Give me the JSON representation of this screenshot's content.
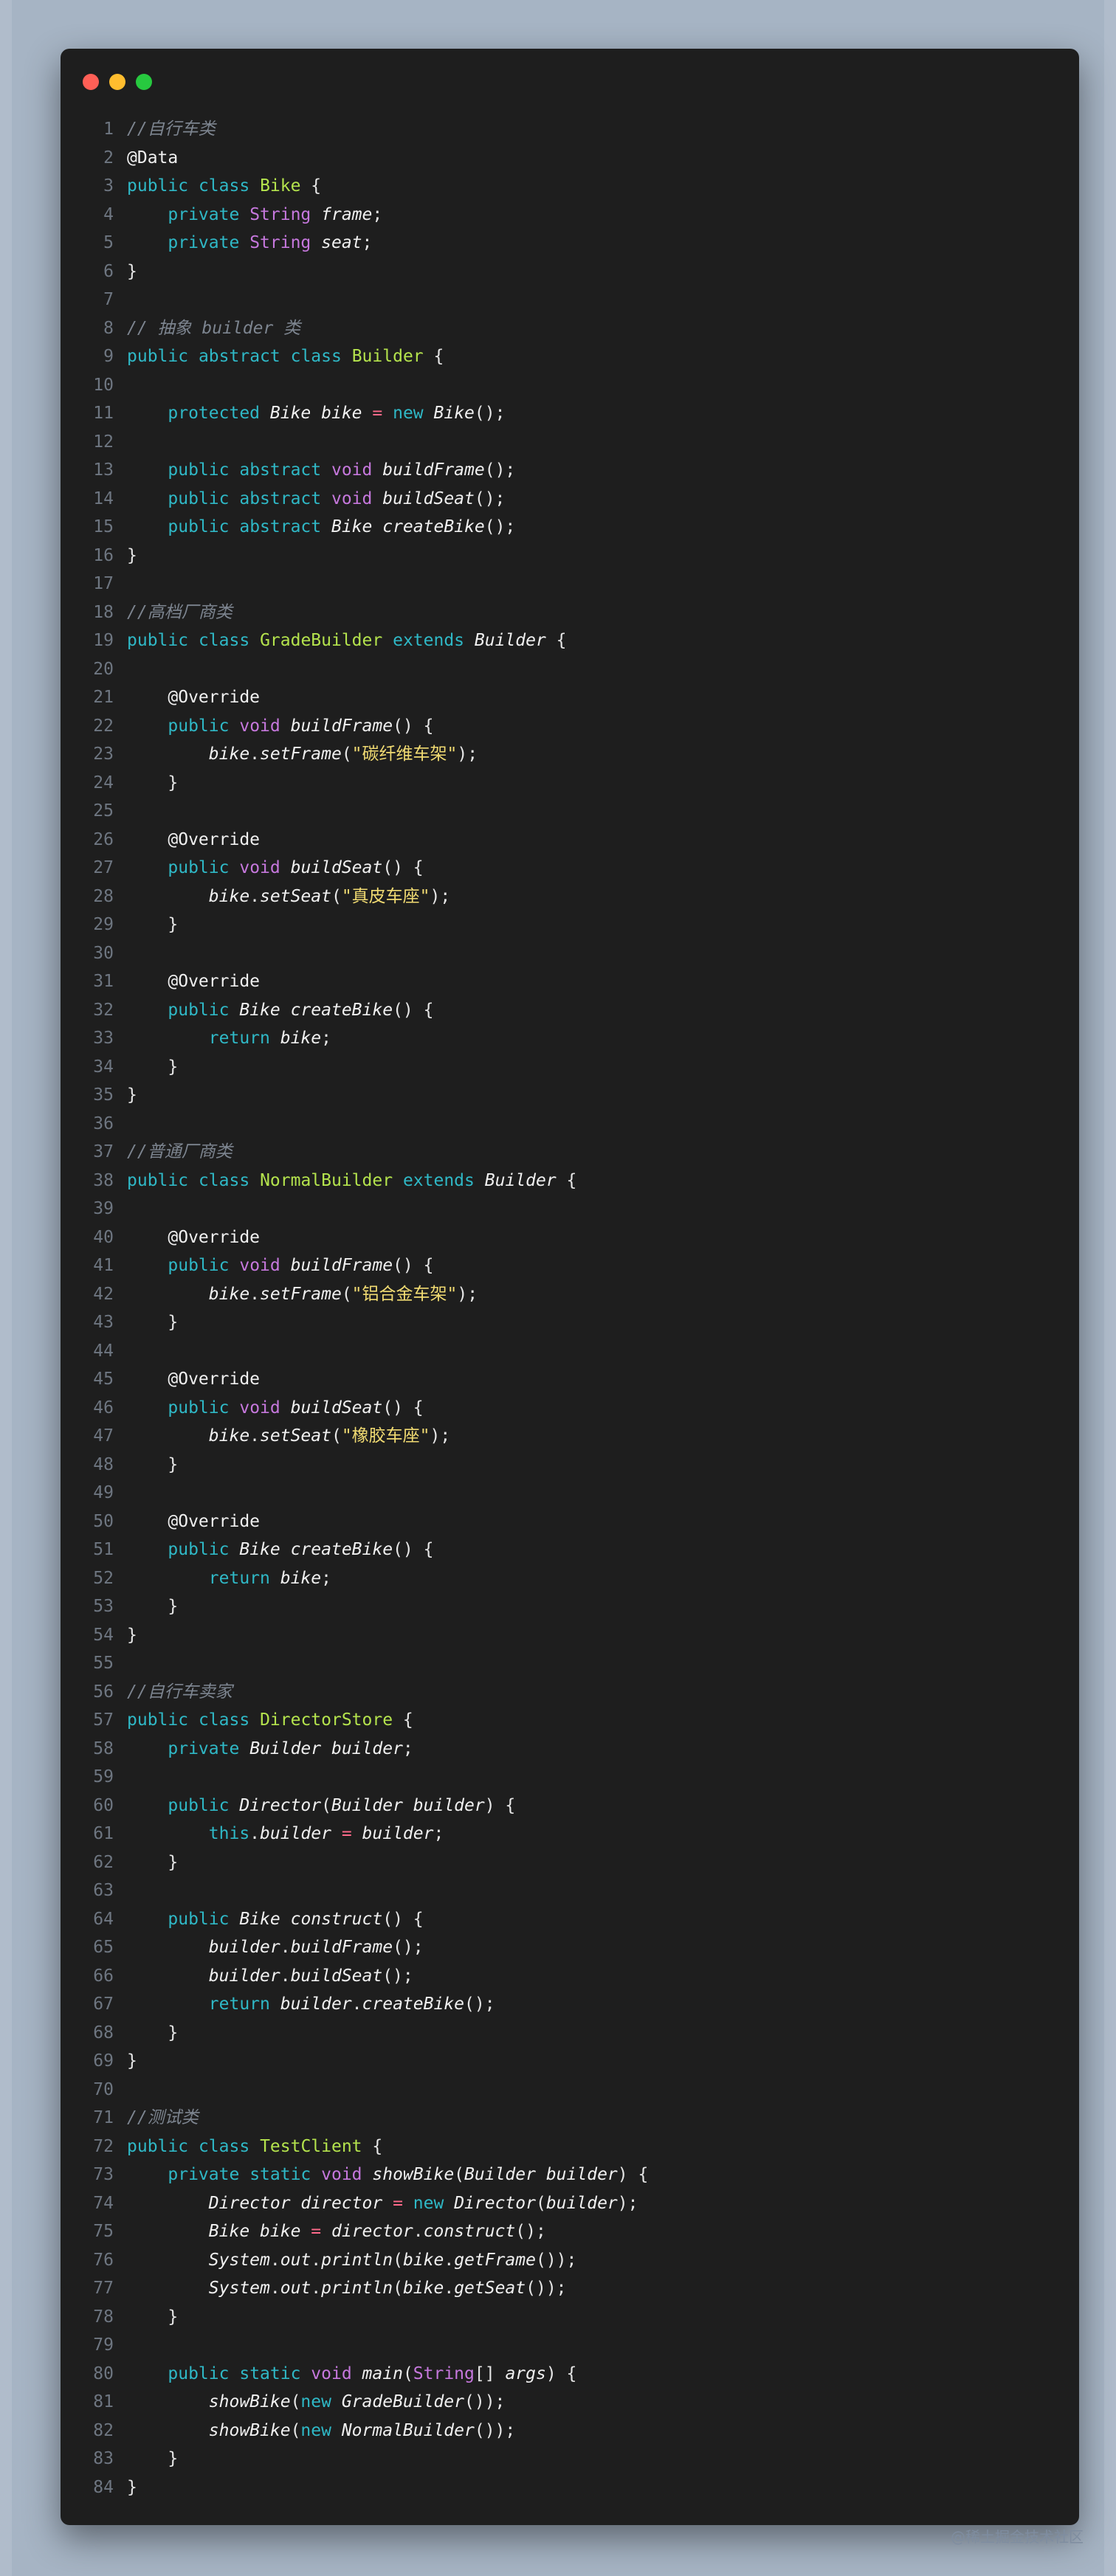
{
  "window_controls": {
    "close_color": "#ff5f56",
    "minimize_color": "#ffbd2e",
    "maximize_color": "#27c93f"
  },
  "code_lines": [
    [
      [
        "cm",
        "//自行车类"
      ]
    ],
    [
      [
        "an",
        "@Data"
      ]
    ],
    [
      [
        "kw",
        "public"
      ],
      [
        "pl",
        " "
      ],
      [
        "kw",
        "class"
      ],
      [
        "pl",
        " "
      ],
      [
        "cl",
        "Bike"
      ],
      [
        "pl",
        " {"
      ]
    ],
    [
      [
        "pl",
        "    "
      ],
      [
        "kw",
        "private"
      ],
      [
        "pl",
        " "
      ],
      [
        "ty",
        "String"
      ],
      [
        "pl",
        " "
      ],
      [
        "it",
        "frame"
      ],
      [
        "pl",
        ";"
      ]
    ],
    [
      [
        "pl",
        "    "
      ],
      [
        "kw",
        "private"
      ],
      [
        "pl",
        " "
      ],
      [
        "ty",
        "String"
      ],
      [
        "pl",
        " "
      ],
      [
        "it",
        "seat"
      ],
      [
        "pl",
        ";"
      ]
    ],
    [
      [
        "pl",
        "}"
      ]
    ],
    [],
    [
      [
        "cm",
        "// 抽象 builder 类"
      ]
    ],
    [
      [
        "kw",
        "public"
      ],
      [
        "pl",
        " "
      ],
      [
        "kw",
        "abstract"
      ],
      [
        "pl",
        " "
      ],
      [
        "kw",
        "class"
      ],
      [
        "pl",
        " "
      ],
      [
        "cl",
        "Builder"
      ],
      [
        "pl",
        " {"
      ]
    ],
    [],
    [
      [
        "pl",
        "    "
      ],
      [
        "kw",
        "protected"
      ],
      [
        "pl",
        " "
      ],
      [
        "it",
        "Bike"
      ],
      [
        "pl",
        " "
      ],
      [
        "it",
        "bike"
      ],
      [
        "pl",
        " "
      ],
      [
        "op",
        "="
      ],
      [
        "pl",
        " "
      ],
      [
        "kw",
        "new"
      ],
      [
        "pl",
        " "
      ],
      [
        "it",
        "Bike"
      ],
      [
        "pl",
        "();"
      ]
    ],
    [],
    [
      [
        "pl",
        "    "
      ],
      [
        "kw",
        "public"
      ],
      [
        "pl",
        " "
      ],
      [
        "kw",
        "abstract"
      ],
      [
        "pl",
        " "
      ],
      [
        "ty",
        "void"
      ],
      [
        "pl",
        " "
      ],
      [
        "it",
        "buildFrame"
      ],
      [
        "pl",
        "();"
      ]
    ],
    [
      [
        "pl",
        "    "
      ],
      [
        "kw",
        "public"
      ],
      [
        "pl",
        " "
      ],
      [
        "kw",
        "abstract"
      ],
      [
        "pl",
        " "
      ],
      [
        "ty",
        "void"
      ],
      [
        "pl",
        " "
      ],
      [
        "it",
        "buildSeat"
      ],
      [
        "pl",
        "();"
      ]
    ],
    [
      [
        "pl",
        "    "
      ],
      [
        "kw",
        "public"
      ],
      [
        "pl",
        " "
      ],
      [
        "kw",
        "abstract"
      ],
      [
        "pl",
        " "
      ],
      [
        "it",
        "Bike"
      ],
      [
        "pl",
        " "
      ],
      [
        "it",
        "createBike"
      ],
      [
        "pl",
        "();"
      ]
    ],
    [
      [
        "pl",
        "}"
      ]
    ],
    [],
    [
      [
        "cm",
        "//高档厂商类"
      ]
    ],
    [
      [
        "kw",
        "public"
      ],
      [
        "pl",
        " "
      ],
      [
        "kw",
        "class"
      ],
      [
        "pl",
        " "
      ],
      [
        "cl",
        "GradeBuilder"
      ],
      [
        "pl",
        " "
      ],
      [
        "kw",
        "extends"
      ],
      [
        "pl",
        " "
      ],
      [
        "it",
        "Builder"
      ],
      [
        "pl",
        " {"
      ]
    ],
    [],
    [
      [
        "pl",
        "    "
      ],
      [
        "an",
        "@Override"
      ]
    ],
    [
      [
        "pl",
        "    "
      ],
      [
        "kw",
        "public"
      ],
      [
        "pl",
        " "
      ],
      [
        "ty",
        "void"
      ],
      [
        "pl",
        " "
      ],
      [
        "it",
        "buildFrame"
      ],
      [
        "pl",
        "() {"
      ]
    ],
    [
      [
        "pl",
        "        "
      ],
      [
        "it",
        "bike"
      ],
      [
        "pl",
        "."
      ],
      [
        "it",
        "setFrame"
      ],
      [
        "pl",
        "("
      ],
      [
        "st",
        "\"碳纤维车架\""
      ],
      [
        "pl",
        ");"
      ]
    ],
    [
      [
        "pl",
        "    }"
      ]
    ],
    [],
    [
      [
        "pl",
        "    "
      ],
      [
        "an",
        "@Override"
      ]
    ],
    [
      [
        "pl",
        "    "
      ],
      [
        "kw",
        "public"
      ],
      [
        "pl",
        " "
      ],
      [
        "ty",
        "void"
      ],
      [
        "pl",
        " "
      ],
      [
        "it",
        "buildSeat"
      ],
      [
        "pl",
        "() {"
      ]
    ],
    [
      [
        "pl",
        "        "
      ],
      [
        "it",
        "bike"
      ],
      [
        "pl",
        "."
      ],
      [
        "it",
        "setSeat"
      ],
      [
        "pl",
        "("
      ],
      [
        "st",
        "\"真皮车座\""
      ],
      [
        "pl",
        ");"
      ]
    ],
    [
      [
        "pl",
        "    }"
      ]
    ],
    [],
    [
      [
        "pl",
        "    "
      ],
      [
        "an",
        "@Override"
      ]
    ],
    [
      [
        "pl",
        "    "
      ],
      [
        "kw",
        "public"
      ],
      [
        "pl",
        " "
      ],
      [
        "it",
        "Bike"
      ],
      [
        "pl",
        " "
      ],
      [
        "it",
        "createBike"
      ],
      [
        "pl",
        "() {"
      ]
    ],
    [
      [
        "pl",
        "        "
      ],
      [
        "kw",
        "return"
      ],
      [
        "pl",
        " "
      ],
      [
        "it",
        "bike"
      ],
      [
        "pl",
        ";"
      ]
    ],
    [
      [
        "pl",
        "    }"
      ]
    ],
    [
      [
        "pl",
        "}"
      ]
    ],
    [],
    [
      [
        "cm",
        "//普通厂商类"
      ]
    ],
    [
      [
        "kw",
        "public"
      ],
      [
        "pl",
        " "
      ],
      [
        "kw",
        "class"
      ],
      [
        "pl",
        " "
      ],
      [
        "cl",
        "NormalBuilder"
      ],
      [
        "pl",
        " "
      ],
      [
        "kw",
        "extends"
      ],
      [
        "pl",
        " "
      ],
      [
        "it",
        "Builder"
      ],
      [
        "pl",
        " {"
      ]
    ],
    [],
    [
      [
        "pl",
        "    "
      ],
      [
        "an",
        "@Override"
      ]
    ],
    [
      [
        "pl",
        "    "
      ],
      [
        "kw",
        "public"
      ],
      [
        "pl",
        " "
      ],
      [
        "ty",
        "void"
      ],
      [
        "pl",
        " "
      ],
      [
        "it",
        "buildFrame"
      ],
      [
        "pl",
        "() {"
      ]
    ],
    [
      [
        "pl",
        "        "
      ],
      [
        "it",
        "bike"
      ],
      [
        "pl",
        "."
      ],
      [
        "it",
        "setFrame"
      ],
      [
        "pl",
        "("
      ],
      [
        "st",
        "\"铝合金车架\""
      ],
      [
        "pl",
        ");"
      ]
    ],
    [
      [
        "pl",
        "    }"
      ]
    ],
    [],
    [
      [
        "pl",
        "    "
      ],
      [
        "an",
        "@Override"
      ]
    ],
    [
      [
        "pl",
        "    "
      ],
      [
        "kw",
        "public"
      ],
      [
        "pl",
        " "
      ],
      [
        "ty",
        "void"
      ],
      [
        "pl",
        " "
      ],
      [
        "it",
        "buildSeat"
      ],
      [
        "pl",
        "() {"
      ]
    ],
    [
      [
        "pl",
        "        "
      ],
      [
        "it",
        "bike"
      ],
      [
        "pl",
        "."
      ],
      [
        "it",
        "setSeat"
      ],
      [
        "pl",
        "("
      ],
      [
        "st",
        "\"橡胶车座\""
      ],
      [
        "pl",
        ");"
      ]
    ],
    [
      [
        "pl",
        "    }"
      ]
    ],
    [],
    [
      [
        "pl",
        "    "
      ],
      [
        "an",
        "@Override"
      ]
    ],
    [
      [
        "pl",
        "    "
      ],
      [
        "kw",
        "public"
      ],
      [
        "pl",
        " "
      ],
      [
        "it",
        "Bike"
      ],
      [
        "pl",
        " "
      ],
      [
        "it",
        "createBike"
      ],
      [
        "pl",
        "() {"
      ]
    ],
    [
      [
        "pl",
        "        "
      ],
      [
        "kw",
        "return"
      ],
      [
        "pl",
        " "
      ],
      [
        "it",
        "bike"
      ],
      [
        "pl",
        ";"
      ]
    ],
    [
      [
        "pl",
        "    }"
      ]
    ],
    [
      [
        "pl",
        "}"
      ]
    ],
    [],
    [
      [
        "cm",
        "//自行车卖家"
      ]
    ],
    [
      [
        "kw",
        "public"
      ],
      [
        "pl",
        " "
      ],
      [
        "kw",
        "class"
      ],
      [
        "pl",
        " "
      ],
      [
        "cl",
        "DirectorStore"
      ],
      [
        "pl",
        " {"
      ]
    ],
    [
      [
        "pl",
        "    "
      ],
      [
        "kw",
        "private"
      ],
      [
        "pl",
        " "
      ],
      [
        "it",
        "Builder"
      ],
      [
        "pl",
        " "
      ],
      [
        "it",
        "builder"
      ],
      [
        "pl",
        ";"
      ]
    ],
    [],
    [
      [
        "pl",
        "    "
      ],
      [
        "kw",
        "public"
      ],
      [
        "pl",
        " "
      ],
      [
        "it",
        "Director"
      ],
      [
        "pl",
        "("
      ],
      [
        "it",
        "Builder"
      ],
      [
        "pl",
        " "
      ],
      [
        "it",
        "builder"
      ],
      [
        "pl",
        ") {"
      ]
    ],
    [
      [
        "pl",
        "        "
      ],
      [
        "kw",
        "this"
      ],
      [
        "pl",
        "."
      ],
      [
        "it",
        "builder"
      ],
      [
        "pl",
        " "
      ],
      [
        "op",
        "="
      ],
      [
        "pl",
        " "
      ],
      [
        "it",
        "builder"
      ],
      [
        "pl",
        ";"
      ]
    ],
    [
      [
        "pl",
        "    }"
      ]
    ],
    [],
    [
      [
        "pl",
        "    "
      ],
      [
        "kw",
        "public"
      ],
      [
        "pl",
        " "
      ],
      [
        "it",
        "Bike"
      ],
      [
        "pl",
        " "
      ],
      [
        "it",
        "construct"
      ],
      [
        "pl",
        "() {"
      ]
    ],
    [
      [
        "pl",
        "        "
      ],
      [
        "it",
        "builder"
      ],
      [
        "pl",
        "."
      ],
      [
        "it",
        "buildFrame"
      ],
      [
        "pl",
        "();"
      ]
    ],
    [
      [
        "pl",
        "        "
      ],
      [
        "it",
        "builder"
      ],
      [
        "pl",
        "."
      ],
      [
        "it",
        "buildSeat"
      ],
      [
        "pl",
        "();"
      ]
    ],
    [
      [
        "pl",
        "        "
      ],
      [
        "kw",
        "return"
      ],
      [
        "pl",
        " "
      ],
      [
        "it",
        "builder"
      ],
      [
        "pl",
        "."
      ],
      [
        "it",
        "createBike"
      ],
      [
        "pl",
        "();"
      ]
    ],
    [
      [
        "pl",
        "    }"
      ]
    ],
    [
      [
        "pl",
        "}"
      ]
    ],
    [],
    [
      [
        "cm",
        "//测试类"
      ]
    ],
    [
      [
        "kw",
        "public"
      ],
      [
        "pl",
        " "
      ],
      [
        "kw",
        "class"
      ],
      [
        "pl",
        " "
      ],
      [
        "cl",
        "TestClient"
      ],
      [
        "pl",
        " {"
      ]
    ],
    [
      [
        "pl",
        "    "
      ],
      [
        "kw",
        "private"
      ],
      [
        "pl",
        " "
      ],
      [
        "kw",
        "static"
      ],
      [
        "pl",
        " "
      ],
      [
        "ty",
        "void"
      ],
      [
        "pl",
        " "
      ],
      [
        "it",
        "showBike"
      ],
      [
        "pl",
        "("
      ],
      [
        "it",
        "Builder"
      ],
      [
        "pl",
        " "
      ],
      [
        "it",
        "builder"
      ],
      [
        "pl",
        ") {"
      ]
    ],
    [
      [
        "pl",
        "        "
      ],
      [
        "it",
        "Director"
      ],
      [
        "pl",
        " "
      ],
      [
        "it",
        "director"
      ],
      [
        "pl",
        " "
      ],
      [
        "op",
        "="
      ],
      [
        "pl",
        " "
      ],
      [
        "kw",
        "new"
      ],
      [
        "pl",
        " "
      ],
      [
        "it",
        "Director"
      ],
      [
        "pl",
        "("
      ],
      [
        "it",
        "builder"
      ],
      [
        "pl",
        ");"
      ]
    ],
    [
      [
        "pl",
        "        "
      ],
      [
        "it",
        "Bike"
      ],
      [
        "pl",
        " "
      ],
      [
        "it",
        "bike"
      ],
      [
        "pl",
        " "
      ],
      [
        "op",
        "="
      ],
      [
        "pl",
        " "
      ],
      [
        "it",
        "director"
      ],
      [
        "pl",
        "."
      ],
      [
        "it",
        "construct"
      ],
      [
        "pl",
        "();"
      ]
    ],
    [
      [
        "pl",
        "        "
      ],
      [
        "it",
        "System"
      ],
      [
        "pl",
        "."
      ],
      [
        "it",
        "out"
      ],
      [
        "pl",
        "."
      ],
      [
        "it",
        "println"
      ],
      [
        "pl",
        "("
      ],
      [
        "it",
        "bike"
      ],
      [
        "pl",
        "."
      ],
      [
        "it",
        "getFrame"
      ],
      [
        "pl",
        "());"
      ]
    ],
    [
      [
        "pl",
        "        "
      ],
      [
        "it",
        "System"
      ],
      [
        "pl",
        "."
      ],
      [
        "it",
        "out"
      ],
      [
        "pl",
        "."
      ],
      [
        "it",
        "println"
      ],
      [
        "pl",
        "("
      ],
      [
        "it",
        "bike"
      ],
      [
        "pl",
        "."
      ],
      [
        "it",
        "getSeat"
      ],
      [
        "pl",
        "());"
      ]
    ],
    [
      [
        "pl",
        "    }"
      ]
    ],
    [],
    [
      [
        "pl",
        "    "
      ],
      [
        "kw",
        "public"
      ],
      [
        "pl",
        " "
      ],
      [
        "kw",
        "static"
      ],
      [
        "pl",
        " "
      ],
      [
        "ty",
        "void"
      ],
      [
        "pl",
        " "
      ],
      [
        "it",
        "main"
      ],
      [
        "pl",
        "("
      ],
      [
        "ty",
        "String"
      ],
      [
        "pl",
        "[] "
      ],
      [
        "it",
        "args"
      ],
      [
        "pl",
        ") {"
      ]
    ],
    [
      [
        "pl",
        "        "
      ],
      [
        "it",
        "showBike"
      ],
      [
        "pl",
        "("
      ],
      [
        "kw",
        "new"
      ],
      [
        "pl",
        " "
      ],
      [
        "it",
        "GradeBuilder"
      ],
      [
        "pl",
        "());"
      ]
    ],
    [
      [
        "pl",
        "        "
      ],
      [
        "it",
        "showBike"
      ],
      [
        "pl",
        "("
      ],
      [
        "kw",
        "new"
      ],
      [
        "pl",
        " "
      ],
      [
        "it",
        "NormalBuilder"
      ],
      [
        "pl",
        "());"
      ]
    ],
    [
      [
        "pl",
        "    }"
      ]
    ],
    [
      [
        "pl",
        "}"
      ]
    ]
  ],
  "watermark": "@稀土掘金技术社区"
}
